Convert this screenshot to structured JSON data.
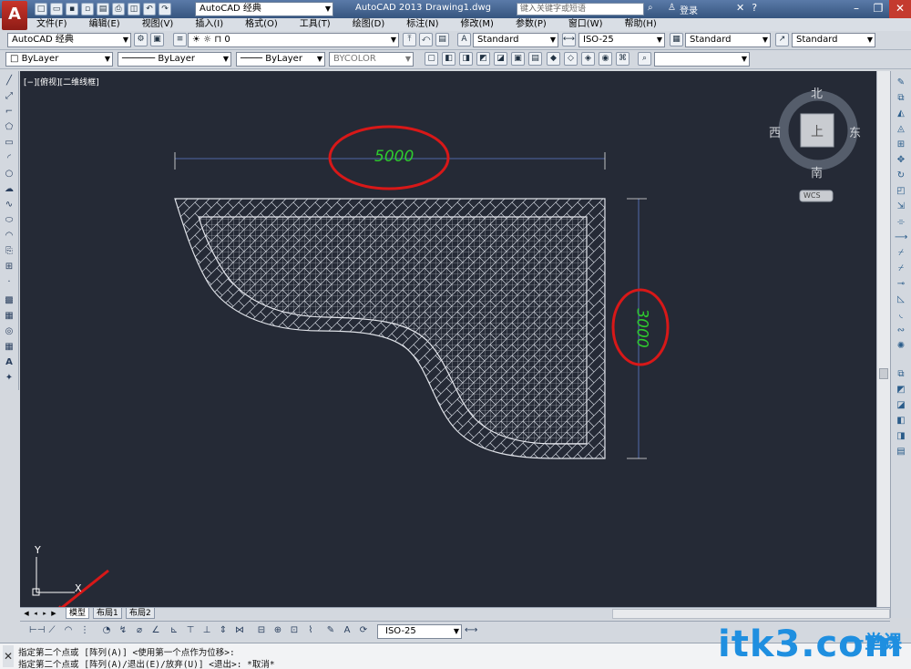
{
  "titlebar": {
    "logo": "A",
    "workspace": "AutoCAD 经典",
    "app_title": "AutoCAD 2013",
    "doc_title": "Drawing1.dwg",
    "search_placeholder": "键入关键字或短语",
    "login": "登录",
    "help": "?"
  },
  "menu": [
    "文件(F)",
    "编辑(E)",
    "视图(V)",
    "插入(I)",
    "格式(O)",
    "工具(T)",
    "绘图(D)",
    "标注(N)",
    "修改(M)",
    "参数(P)",
    "窗口(W)",
    "帮助(H)"
  ],
  "toolbar1": {
    "workspace_combo": "AutoCAD 经典",
    "layer_value": "0",
    "text_style": "Standard",
    "dim_style": "ISO-25",
    "table_style": "Standard",
    "multileader_style": "Standard"
  },
  "toolbar2": {
    "color": "ByLayer",
    "linetype": "ByLayer",
    "lineweight": "ByLayer",
    "plotstyle": "BYCOLOR"
  },
  "canvas": {
    "viewport_label": "[−][俯视][二维线框]",
    "dim_horizontal": "5000",
    "dim_vertical": "3000",
    "ucs_x": "X",
    "ucs_y": "Y"
  },
  "viewcube": {
    "north": "北",
    "south": "南",
    "east": "东",
    "west": "西",
    "face": "上",
    "wcs": "WCS"
  },
  "tabs": [
    "模型",
    "布局1",
    "布局2"
  ],
  "dim_toolbar": {
    "dim_style": "ISO-25"
  },
  "command": [
    "指定第二个点或 [阵列(A)] <使用第一个点作为位移>:",
    "指定第二个点或 [阵列(A)/退出(E)/放弃(U)] <退出>: *取消*"
  ],
  "watermark": {
    "main": "itk3.com",
    "sub": "一堂课"
  },
  "colors": {
    "canvas_bg": "#252a36",
    "dimension_text": "#2ecc2e",
    "highlight": "#d81818",
    "watermark": "#1f8fe0"
  }
}
